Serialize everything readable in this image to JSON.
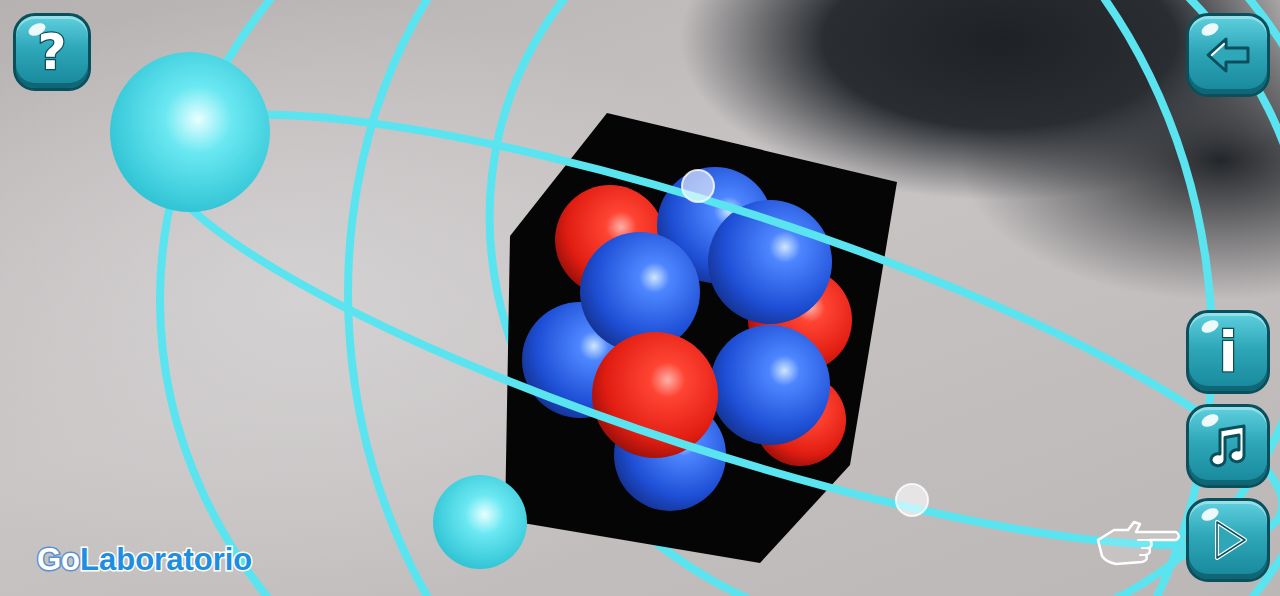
{
  "app": {
    "logo": {
      "prefix": "Go",
      "name": "Laboratorio"
    }
  },
  "top_bar": {
    "help_button": {
      "label": "?"
    },
    "back_button": {
      "kind": "back"
    }
  },
  "side_buttons": [
    {
      "kind": "info",
      "label": "i"
    },
    {
      "kind": "music"
    },
    {
      "kind": "play"
    }
  ]
}
